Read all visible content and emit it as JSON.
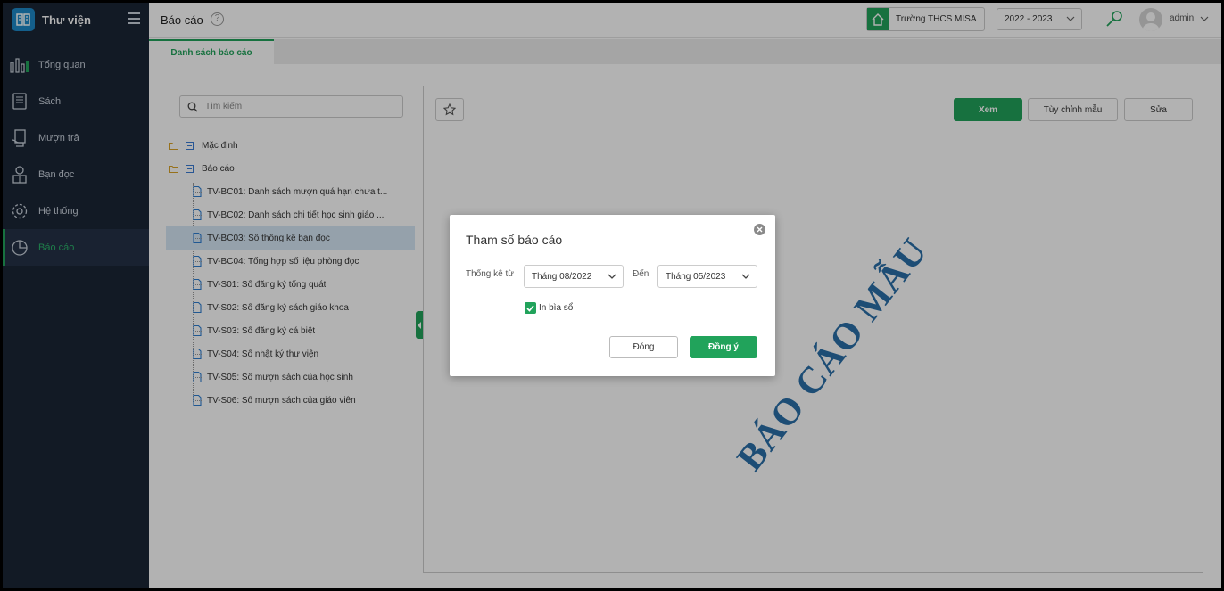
{
  "sidebar": {
    "brand": "Thư viện",
    "items": [
      {
        "label": "Tổng quan",
        "icon": "chart-bars-icon"
      },
      {
        "label": "Sách",
        "icon": "book-icon"
      },
      {
        "label": "Mượn trả",
        "icon": "borrow-icon"
      },
      {
        "label": "Bạn đọc",
        "icon": "reader-icon"
      },
      {
        "label": "Hệ thống",
        "icon": "gear-icon"
      },
      {
        "label": "Báo cáo",
        "icon": "pie-chart-icon",
        "active": true
      }
    ]
  },
  "header": {
    "title": "Báo cáo",
    "school": "Trường THCS MISA",
    "year": "2022 - 2023",
    "user": "admin"
  },
  "tabs": {
    "active": "Danh sách báo cáo"
  },
  "tree": {
    "search_placeholder": "Tìm kiếm",
    "folders": [
      {
        "label": "Mặc định"
      },
      {
        "label": "Báo cáo"
      }
    ],
    "items": [
      {
        "label": "TV-BC01: Danh sách mượn quá hạn chưa t..."
      },
      {
        "label": "TV-BC02: Danh sách chi tiết học sinh giáo ..."
      },
      {
        "label": "TV-BC03: Sổ thống kê bạn đọc",
        "selected": true
      },
      {
        "label": "TV-BC04: Tổng hợp số liệu phòng đọc"
      },
      {
        "label": "TV-S01: Sổ đăng ký tổng quát"
      },
      {
        "label": "TV-S02: Sổ đăng ký sách giáo khoa"
      },
      {
        "label": "TV-S03: Sổ đăng ký cá biệt"
      },
      {
        "label": "TV-S04: Sổ nhật ký thư viện"
      },
      {
        "label": "TV-S05: Sổ mượn sách của học sinh"
      },
      {
        "label": "TV-S06: Sổ mượn sách của giáo viên"
      }
    ]
  },
  "panel": {
    "view_label": "Xem",
    "customize_label": "Tùy chỉnh mẫu",
    "edit_label": "Sửa",
    "watermark": "BÁO CÁO MẪU"
  },
  "dialog": {
    "title": "Tham số báo cáo",
    "from_label": "Thống kê từ",
    "from_value": "Tháng 08/2022",
    "to_label": "Đến",
    "to_value": "Tháng 05/2023",
    "checkbox_label": "In bìa sổ",
    "checkbox_checked": true,
    "close_label": "Đóng",
    "ok_label": "Đồng ý"
  },
  "colors": {
    "accent": "#21a35b",
    "sidebar_bg": "#1b2636",
    "watermark": "#2a6fa8",
    "selected_row": "#d6e7f5"
  }
}
